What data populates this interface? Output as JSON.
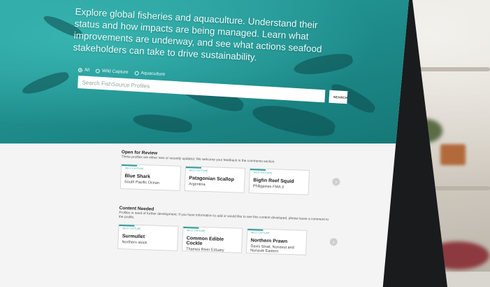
{
  "hero": {
    "intro": "Explore global fisheries and aquaculture. Understand their status and how impacts are being managed. Learn what improvements are underway, and see what actions seafood stakeholders can take to drive sustainability.",
    "filters": [
      {
        "label": "All",
        "selected": true
      },
      {
        "label": "Wild Capture",
        "selected": false
      },
      {
        "label": "Aquaculture",
        "selected": false
      }
    ],
    "search_placeholder": "Search FishSource Profiles",
    "search_button": "SEARCH"
  },
  "open_for_review": {
    "title": "Open for Review",
    "description": "These profiles are either new or recently updated. We welcome your feedback in the comments section.",
    "cards": [
      {
        "tag": "WILD CAPTURE",
        "name": "Blue Shark",
        "location": "South Pacific Ocean"
      },
      {
        "tag": "WILD CAPTURE",
        "name": "Patagonian Scallop",
        "location": "Argentina"
      },
      {
        "tag": "WILD CAPTURE",
        "name": "Bigfin Reef Squid",
        "location": "Philippines FMA 3"
      }
    ]
  },
  "content_needed": {
    "title": "Content Needed",
    "description": "Profiles in need of further development. If you have information to add or would like to see this content developed, please leave a comment to the profile.",
    "cards": [
      {
        "tag": "WILD CAPTURE",
        "name": "Surmullet",
        "location": "Northern stock"
      },
      {
        "tag": "WILD CAPTURE",
        "name": "Common Edible Cockle",
        "location": "Thames River Estuary"
      },
      {
        "tag": "WILD CAPTURE",
        "name": "Northern Prawn",
        "location": "Davis Strait, Nunavut and Nunavik Eastern"
      }
    ]
  },
  "colors": {
    "accent": "#2b9c99",
    "hero": "#1f8e8d"
  }
}
